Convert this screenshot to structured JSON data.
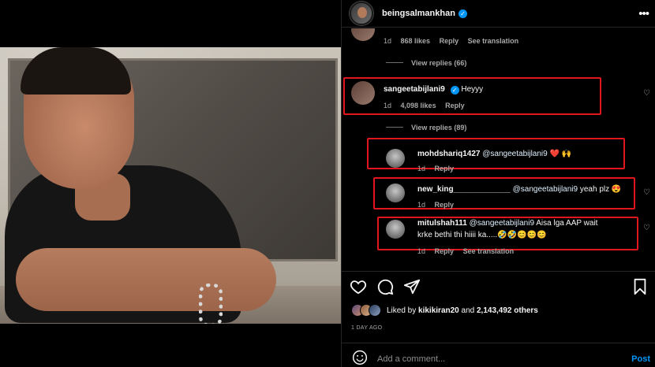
{
  "post": {
    "username": "beingsalmankhan",
    "more_icon": "more-horizontal-icon",
    "image_alt": "post-photo"
  },
  "comments": {
    "top_meta": {
      "time": "1d",
      "likes": "868 likes",
      "reply": "Reply",
      "see_translation": "See translation"
    },
    "view_replies_1": "View replies (66)",
    "main_comment": {
      "username": "sangeetabijlani9",
      "text": "Heyyy",
      "time": "1d",
      "likes": "4,098 likes",
      "reply": "Reply"
    },
    "view_replies_2": "View replies (89)",
    "replies": [
      {
        "username": "mohdshariq1427",
        "mention": "@sangeetabijlani9",
        "text": " ❤️ 🙌",
        "time": "1d",
        "reply": "Reply"
      },
      {
        "username": "new_king_____________",
        "mention": "@sangeetabijlani9",
        "text": " yeah plz 😍",
        "time": "1d",
        "reply": "Reply"
      },
      {
        "username": "mitulshah111",
        "mention": "@sangeetabijlani9",
        "text": " Aisa lga AAP wait",
        "text2": "krke bethi thi hiiii ka.....🤣🤣😊😊😊",
        "time": "1d",
        "reply": "Reply",
        "see_translation": "See translation"
      }
    ]
  },
  "likes": {
    "liked_by": "Liked by ",
    "user": "kikikiran20",
    "and": " and ",
    "count": "2,143,492 others"
  },
  "time_ago": "1 DAY AGO",
  "add_comment": {
    "placeholder": "Add a comment...",
    "post_label": "Post"
  },
  "colors": {
    "highlight": "#e0161e",
    "link_blue": "#0095f6",
    "verified": "#0095f6"
  }
}
